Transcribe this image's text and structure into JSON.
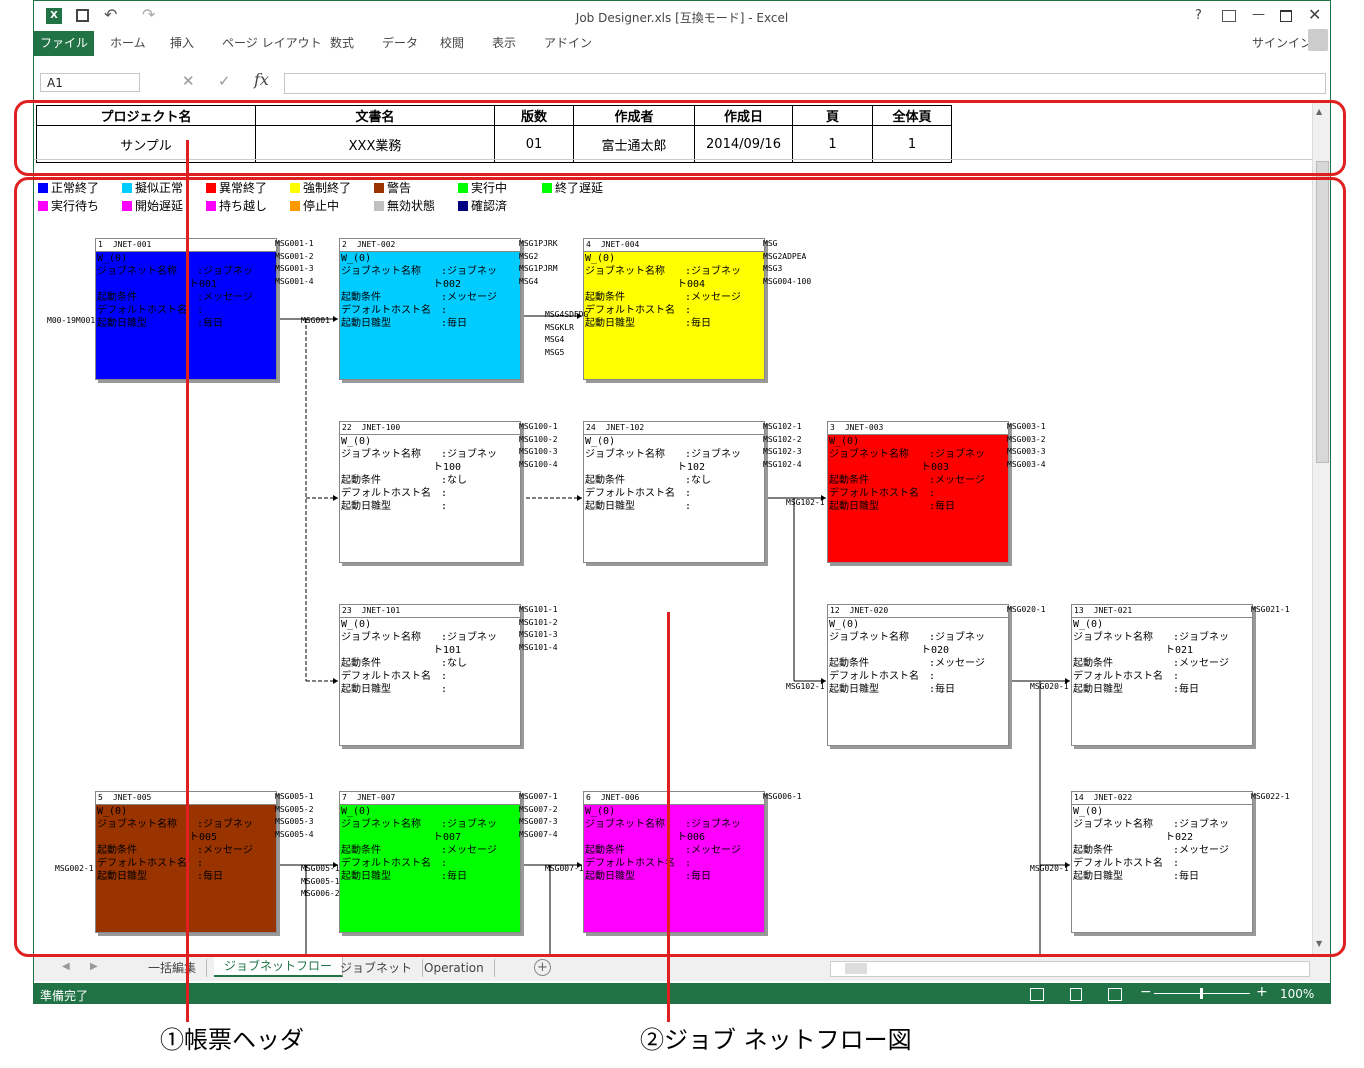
{
  "window": {
    "title": "Job Designer.xls  [互換モード] - Excel",
    "signin": "サインイン",
    "help": "?"
  },
  "ribbon": {
    "file": "ファイル",
    "tabs": [
      "ホーム",
      "挿入",
      "ページ レイアウト",
      "数式",
      "データ",
      "校閲",
      "表示",
      "アドイン"
    ]
  },
  "formula": {
    "namebox": "A1",
    "fx": "fx"
  },
  "header_table": {
    "headers": [
      "プロジェクト名",
      "文書名",
      "版数",
      "作成者",
      "作成日",
      "頁",
      "全体頁"
    ],
    "values": [
      "サンプル",
      "XXX業務",
      "01",
      "富士通太郎",
      "2014/09/16",
      "1",
      "1"
    ]
  },
  "legend": [
    {
      "label": "正常終了",
      "color": "#0000ff"
    },
    {
      "label": "擬似正常",
      "color": "#00ccff"
    },
    {
      "label": "異常終了",
      "color": "#ff0000"
    },
    {
      "label": "強制終了",
      "color": "#ffff00"
    },
    {
      "label": "警告",
      "color": "#993300"
    },
    {
      "label": "実行中",
      "color": "#00ff00"
    },
    {
      "label": "終了遅延",
      "color": "#00ff00"
    },
    {
      "label": "実行待ち",
      "color": "#ff00ff"
    },
    {
      "label": "開始遅延",
      "color": "#ff00ff"
    },
    {
      "label": "持ち越し",
      "color": "#ff00ff"
    },
    {
      "label": "停止中",
      "color": "#ff9900"
    },
    {
      "label": "無効状態",
      "color": "#c0c0c0"
    },
    {
      "label": "確認済",
      "color": "#000080"
    }
  ],
  "field_labels": {
    "w": "W_(0)",
    "name": "ジョブネット名称",
    "cond": "起動条件",
    "host": "デフォルトホスト名",
    "cal": "起動日雛型"
  },
  "nodes": [
    {
      "num": "1",
      "id": "JNET-001",
      "color": "#0000ff",
      "name": ":ジョブネッ",
      "name2": "ト001",
      "cond": ":メッセージ",
      "host": ":",
      "cal": ":毎日"
    },
    {
      "num": "2",
      "id": "JNET-002",
      "color": "#00ccff",
      "name": ":ジョブネッ",
      "name2": "ト002",
      "cond": ":メッセージ",
      "host": ":",
      "cal": ":毎日"
    },
    {
      "num": "4",
      "id": "JNET-004",
      "color": "#ffff00",
      "name": ":ジョブネッ",
      "name2": "ト004",
      "cond": ":メッセージ",
      "host": ":",
      "cal": ":毎日"
    },
    {
      "num": "22",
      "id": "JNET-100",
      "color": "#ffffff",
      "name": ":ジョブネッ",
      "name2": "ト100",
      "cond": ":なし",
      "host": ":",
      "cal": ":"
    },
    {
      "num": "24",
      "id": "JNET-102",
      "color": "#ffffff",
      "name": ":ジョブネッ",
      "name2": "ト102",
      "cond": ":なし",
      "host": ":",
      "cal": ":"
    },
    {
      "num": "3",
      "id": "JNET-003",
      "color": "#ff0000",
      "name": ":ジョブネッ",
      "name2": "ト003",
      "cond": ":メッセージ",
      "host": ":",
      "cal": ":毎日"
    },
    {
      "num": "23",
      "id": "JNET-101",
      "color": "#ffffff",
      "name": ":ジョブネッ",
      "name2": "ト101",
      "cond": ":なし",
      "host": ":",
      "cal": ":"
    },
    {
      "num": "12",
      "id": "JNET-020",
      "color": "#ffffff",
      "name": ":ジョブネッ",
      "name2": "ト020",
      "cond": ":メッセージ",
      "host": ":",
      "cal": ":毎日"
    },
    {
      "num": "13",
      "id": "JNET-021",
      "color": "#ffffff",
      "name": ":ジョブネッ",
      "name2": "ト021",
      "cond": ":メッセージ",
      "host": ":",
      "cal": ":毎日"
    },
    {
      "num": "5",
      "id": "JNET-005",
      "color": "#993300",
      "name": ":ジョブネッ",
      "name2": "ト005",
      "cond": ":メッセージ",
      "host": ":",
      "cal": ":毎日"
    },
    {
      "num": "7",
      "id": "JNET-007",
      "color": "#00ff00",
      "name": ":ジョブネッ",
      "name2": "ト007",
      "cond": ":メッセージ",
      "host": ":",
      "cal": ":毎日"
    },
    {
      "num": "6",
      "id": "JNET-006",
      "color": "#ff00ff",
      "name": ":ジョブネッ",
      "name2": "ト006",
      "cond": ":メッセージ",
      "host": ":",
      "cal": ":毎日"
    },
    {
      "num": "14",
      "id": "JNET-022",
      "color": "#ffffff",
      "name": ":ジョブネッ",
      "name2": "ト022",
      "cond": ":メッセージ",
      "host": ":",
      "cal": ":毎日"
    }
  ],
  "msgs": [
    "MSG001-1\nMSG001-2\nMSG001-3\nMSG001-4",
    "MSG1PJRK\nMSG2\nMSG1PJRM\nMSG4",
    "MSG\nMSG2ADPEA\nMSG3\nMSG004-100",
    "MSG100-1\nMSG100-2\nMSG100-3\nMSG100-4",
    "MSG102-1\nMSG102-2\nMSG102-3\nMSG102-4",
    "MSG003-1\nMSG003-2\nMSG003-3\nMSG003-4",
    "MSG101-1\nMSG101-2\nMSG101-3\nMSG101-4",
    "MSG020-1",
    "MSG021-1",
    "MSG005-1\nMSG005-2\nMSG005-3\nMSG005-4",
    "MSG007-1\nMSG007-2\nMSG007-3\nMSG007-4",
    "MSG006-1",
    "MSG022-1",
    "M00-19M001",
    "MSG001",
    "MSG4SDFDG\nMSGKLR\nMSG4\nMSG5",
    "MSG102-1",
    "MSG102-1",
    "MSG020-1",
    "MSG002-1",
    "MSG005-1\nMSG005-1\nMSG006-2",
    "MSG007-1",
    "MSG020-1"
  ],
  "sheets": [
    "一括編集",
    "ジョブネットフロー",
    "ジョブネット",
    "Operation"
  ],
  "status": {
    "ready": "準備完了",
    "zoom": "100%"
  },
  "annotations": {
    "header": "①帳票ヘッダ",
    "flow": "②ジョブ ネットフロー図"
  }
}
